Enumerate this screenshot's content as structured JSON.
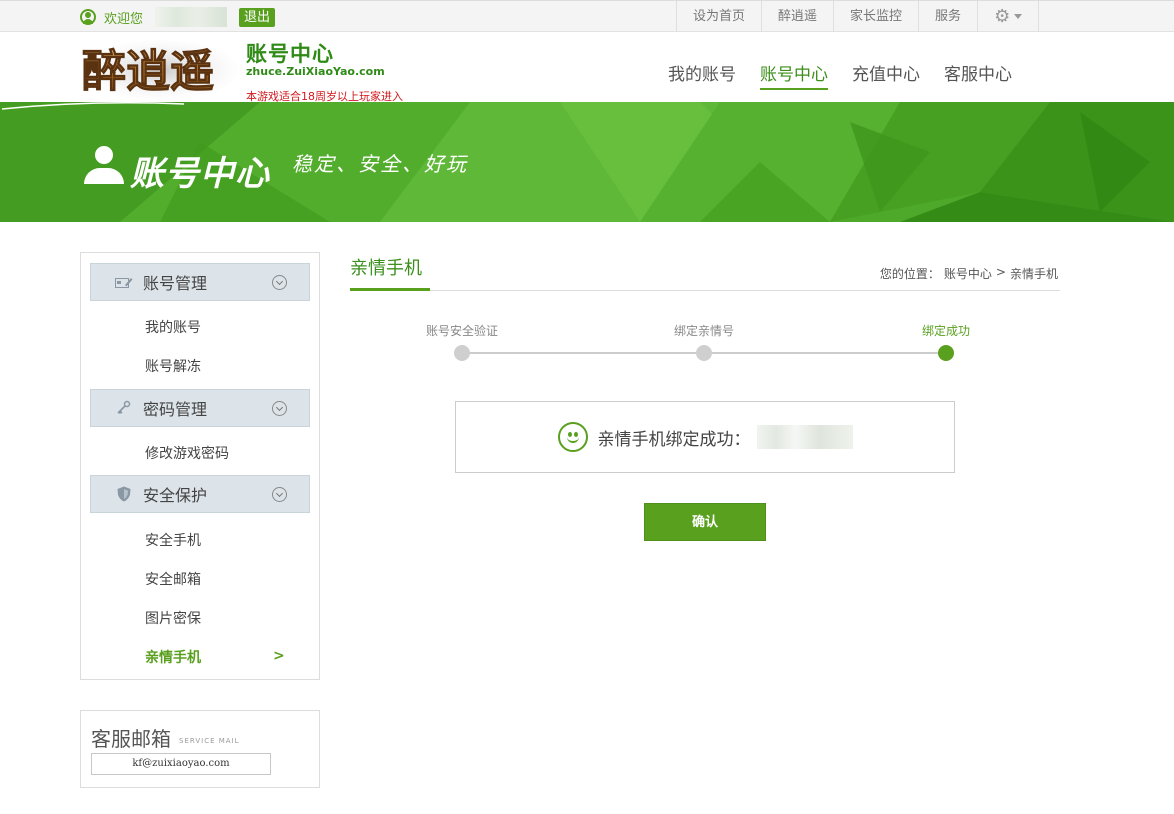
{
  "topbar": {
    "welcome": "欢迎您",
    "logout": "退出",
    "links": [
      "设为首页",
      "醉逍遥",
      "家长监控",
      "服务"
    ]
  },
  "header": {
    "logo_text": "醉逍遥",
    "title": "账号中心",
    "domain": "zhuce.ZuiXiaoYao.com",
    "age_notice": "本游戏适合18周岁以上玩家进入",
    "nav": [
      "我的账号",
      "账号中心",
      "充值中心",
      "客服中心"
    ],
    "active_nav": "账号中心"
  },
  "banner": {
    "title": "账号中心",
    "slogan": "稳定、安全、好玩"
  },
  "sidebar": {
    "sections": [
      {
        "label": "账号管理",
        "items": [
          "我的账号",
          "账号解冻"
        ]
      },
      {
        "label": "密码管理",
        "items": [
          "修改游戏密码"
        ]
      },
      {
        "label": "安全保护",
        "items": [
          "安全手机",
          "安全邮箱",
          "图片密保",
          "亲情手机"
        ]
      }
    ],
    "active_item": "亲情手机",
    "active_arrow": ">"
  },
  "mailbox": {
    "title": "客服邮箱",
    "subtitle": "SERVICE MAIL",
    "address": "kf@zuixiaoyao.com"
  },
  "content": {
    "title": "亲情手机",
    "breadcrumb": {
      "prefix": "您的位置：",
      "items": [
        "账号中心",
        "亲情手机"
      ],
      "separator": ">"
    },
    "steps": [
      {
        "label": "账号安全验证",
        "done": false
      },
      {
        "label": "绑定亲情号",
        "done": false
      },
      {
        "label": "绑定成功",
        "done": true
      }
    ],
    "success_message": "亲情手机绑定成功：",
    "confirm": "确认"
  },
  "colors": {
    "accent": "#5aa01f",
    "accent_dark": "#2f8a16",
    "notice_red": "#d0181c",
    "banner_green": "#4ea829"
  }
}
